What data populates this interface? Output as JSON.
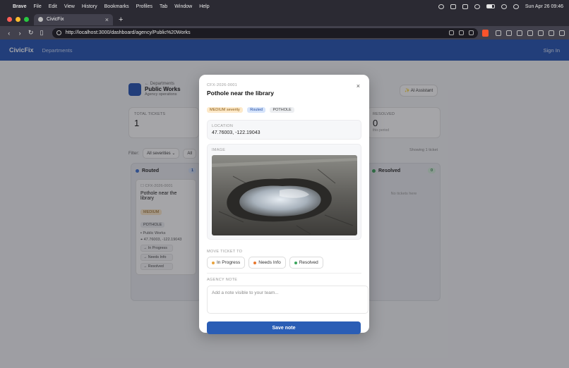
{
  "menubar": {
    "app": "Brave",
    "items": [
      "File",
      "Edit",
      "View",
      "History",
      "Bookmarks",
      "Profiles",
      "Tab",
      "Window",
      "Help"
    ],
    "clock": "Sun Apr 26  09:46"
  },
  "browser": {
    "tab_title": "CivicFix",
    "url": "http://localhost:3000/dashboard/agency/Public%20Works"
  },
  "app": {
    "brand": "CivicFix",
    "nav": "Departments",
    "signin": "Sign In"
  },
  "department": {
    "crumb": "← Departments",
    "name": "Public Works",
    "sub": "Agency operations",
    "ai_button": "✨ AI Assistant"
  },
  "stats": {
    "total_label": "TOTAL TICKETS",
    "total_value": "1",
    "resolved_label": "RESOLVED",
    "resolved_value": "0",
    "resolved_sub": "this period"
  },
  "filters": {
    "label": "Filter:",
    "severity": "All severities",
    "category": "All",
    "showing": "Showing 1 ticket"
  },
  "columns": {
    "routed": {
      "title": "Routed",
      "count": "1"
    },
    "resolved": {
      "title": "Resolved",
      "count": "0",
      "empty": "No tickets here"
    }
  },
  "bg_ticket": {
    "id": "CFX-2026-0001",
    "title": "Pothole near the library",
    "severity": "MEDIUM",
    "category": "POTHOLE",
    "dept": "Public Works",
    "coords": "47.76003, -122.19043",
    "actions": [
      "→ In Progress",
      "→ Needs Info",
      "→ Resolved"
    ]
  },
  "modal": {
    "id": "CFX-2026-0001",
    "title": "Pothole near the library",
    "severity_tag": "MEDIUM severity",
    "status_tag": "Routed",
    "category_tag": "POTHOLE",
    "location_label": "LOCATION",
    "location_value": "47.76003, -122.19043",
    "image_label": "IMAGE",
    "move_label": "MOVE TICKET TO",
    "move_options": [
      {
        "label": "In Progress",
        "color": "#e8a33d"
      },
      {
        "label": "Needs Info",
        "color": "#e8762d"
      },
      {
        "label": "Resolved",
        "color": "#3aa55c"
      }
    ],
    "note_label": "AGENCY NOTE",
    "note_placeholder": "Add a note visible to your team...",
    "save_label": "Save note"
  },
  "colors": {
    "brand_blue": "#1e4fb0",
    "button_blue": "#2a5db5"
  },
  "icons": [
    "apple-icon",
    "close-icon",
    "pin-icon",
    "building-icon",
    "sparkle-icon",
    "checkbox-icon"
  ]
}
